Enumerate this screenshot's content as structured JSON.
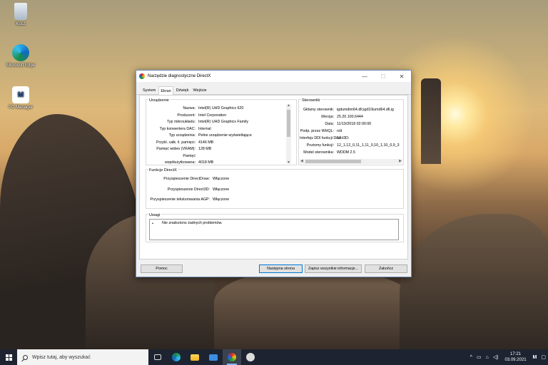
{
  "desktop": {
    "icons": [
      {
        "label": "Kosz"
      },
      {
        "label": "Microsoft Edge"
      },
      {
        "label": "PC Manager"
      }
    ]
  },
  "window": {
    "title": "Narzędzie diagnostyczne DirectX",
    "tabs": [
      "System",
      "Ekran",
      "Dźwięk",
      "Wejście"
    ],
    "active_tab": "Ekran",
    "device_group": {
      "title": "Urządzenie",
      "rows": [
        {
          "k": "Nazwa:",
          "v": "Intel(R) UHD Graphics 620"
        },
        {
          "k": "Producent:",
          "v": "Intel Corporation"
        },
        {
          "k": "Typ mikroukładu:",
          "v": "Intel(R) UHD Graphics Family"
        },
        {
          "k": "Typ konwertera DAC:",
          "v": "Internal"
        },
        {
          "k": "Typ urządzenia:",
          "v": "Pełne urządzenie wyświetlające"
        },
        {
          "k": "Przybl. całk. il. pamięci:",
          "v": "4146 MB"
        },
        {
          "k": "Pamięć wideo (VRAM):",
          "v": "128 MB"
        },
        {
          "k": "Pamięć",
          "v": ""
        },
        {
          "k": "współużytkowana:",
          "v": "4018 MB"
        }
      ]
    },
    "drivers_group": {
      "title": "Sterowniki",
      "rows": [
        {
          "k": "Główny sterownik:",
          "v": "igdumdim64.dll,igd10iumd64.dll,ig"
        },
        {
          "k": "Wersja:",
          "v": "25.20.100.6444"
        },
        {
          "k": "Data:",
          "v": "11/19/2018 02:00:00"
        },
        {
          "k": "Podp. przez WHQL:",
          "v": "n/d"
        },
        {
          "k": "Interfejs DDI funkcji Direct3D:",
          "v": "12"
        },
        {
          "k": "Poziomy funkcji:",
          "v": "12_1,12_0,11_1,11_0,10_1,10_0,9_3"
        },
        {
          "k": "Model sterownika:",
          "v": "WDDM 2.5"
        }
      ]
    },
    "directx_group": {
      "title": "Funkcje DirectX",
      "rows": [
        {
          "k": "Przyspieszenie DirectDraw:",
          "v": "Włączone"
        },
        {
          "k": "Przyspieszenie Direct3D:",
          "v": "Włączone"
        },
        {
          "k": "Przyspieszenie teksturowania AGP:",
          "v": "Włączone"
        }
      ]
    },
    "notes_group": {
      "title": "Uwagi",
      "bullet": "•",
      "text": "Nie znaleziono żadnych problemów."
    },
    "buttons": {
      "help": "Pomoc",
      "next": "Następna strona",
      "save": "Zapisz wszystkie informacje...",
      "exit": "Zakończ"
    },
    "controls": {
      "minimize": "—",
      "maximize": "☐",
      "close": "✕"
    }
  },
  "taskbar": {
    "search_placeholder": "Wpisz tutaj, aby wyszukać",
    "time": "17:21",
    "date": "03.09.2021"
  },
  "colors": {
    "accent": "#0078d7",
    "taskbar": "#1d2330"
  }
}
